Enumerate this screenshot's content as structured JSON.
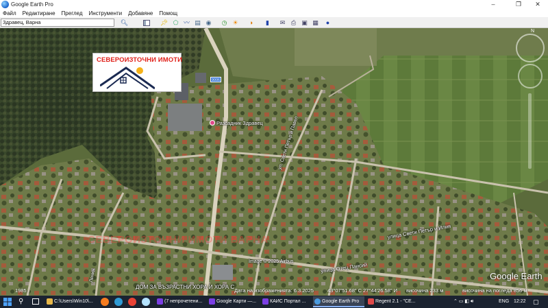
{
  "window": {
    "title": "Google Earth Pro",
    "controls": [
      "–",
      "❐",
      "✕"
    ]
  },
  "menu": [
    "Файл",
    "Редактиране",
    "Преглед",
    "Инструменти",
    "Добавяне",
    "Помощ"
  ],
  "search": {
    "value": "Здравец, Варна"
  },
  "map": {
    "ad_title": "СЕВЕРОИЗТОЧНИ ИМОТИ",
    "road_shield": "9006",
    "place_label": "Разсадник Здравец",
    "watermark": "СЕВЕРОИЗТОЧНИ ИМОТИ ВАРНА",
    "streets": [
      "ул. Свети Петър и Павел",
      "улица Свети Петър и Илия",
      "улица Отец Паисий",
      "Ленин"
    ],
    "bottom_label": "ДОМ ЗА ВЪЗРАСТНИ ХОРА И ХОРА С",
    "image_credit": "Image © 2025 Airbus",
    "logo": "Google Earth",
    "year": "1985"
  },
  "status": {
    "date": "Дата на изображенията: 6.3.2025",
    "lat": "43°07'51.68\" С",
    "lon": "27°44'26.58\" И",
    "elevation": "височина 233 м",
    "eye_alt": "височина на погледа  856 м"
  },
  "taskbar": {
    "items": [
      {
        "label": "C:\\Users\\Win10\\...",
        "color": "#e8b84a"
      },
      {
        "label": "(7 непрочетени...",
        "color": "#7b3fe4"
      },
      {
        "label": "Google Карти —...",
        "color": "#7b3fe4"
      },
      {
        "label": "КАИС Портал ...",
        "color": "#7b3fe4"
      },
      {
        "label": "Google Earth Pro",
        "color": "#4a9be0"
      },
      {
        "label": "Regent 2.1 - \"CE...",
        "color": "#e04a4a"
      }
    ],
    "lang": "ENG",
    "time": "12:22"
  }
}
